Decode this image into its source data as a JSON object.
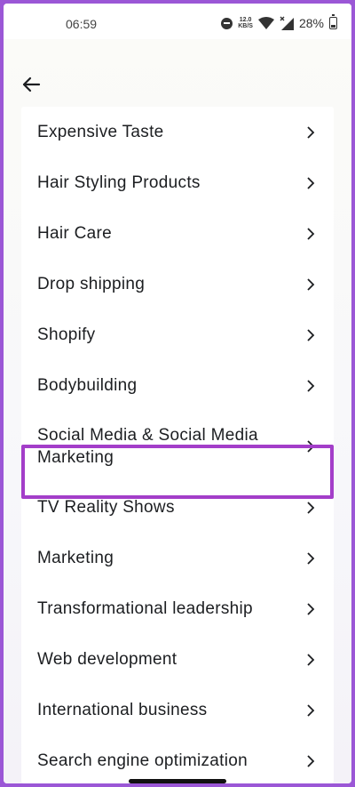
{
  "status_bar": {
    "time": "06:59",
    "net_speed_value": "12.0",
    "net_speed_unit": "KB/S",
    "battery_percent": "28%",
    "battery_level": 0.28
  },
  "header": {
    "back_icon": "arrow-left-icon"
  },
  "list": {
    "items": [
      {
        "label": "Expensive Taste"
      },
      {
        "label": "Hair Styling Products"
      },
      {
        "label": "Hair Care"
      },
      {
        "label": "Drop shipping"
      },
      {
        "label": "Shopify"
      },
      {
        "label": "Bodybuilding"
      },
      {
        "label": "Social Media & Social Media Marketing"
      },
      {
        "label": "TV Reality Shows"
      },
      {
        "label": "Marketing"
      },
      {
        "label": "Transformational leadership"
      },
      {
        "label": "Web development"
      },
      {
        "label": "International business"
      },
      {
        "label": "Search engine optimization"
      }
    ],
    "highlighted_index": 7
  },
  "colors": {
    "frame_border": "#9b57d6",
    "highlight": "#a33ec9",
    "text": "#1c1e21"
  }
}
